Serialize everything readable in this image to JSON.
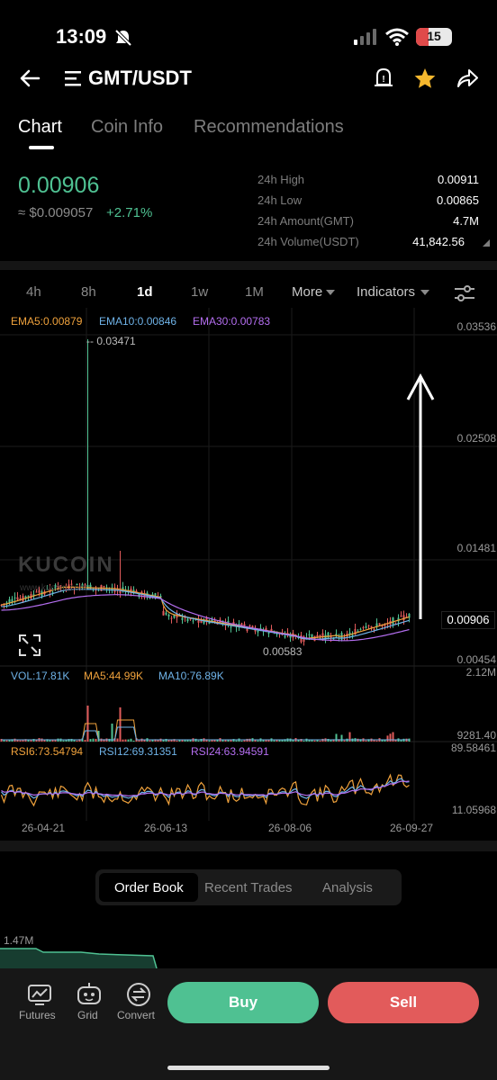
{
  "status": {
    "time": "13:09",
    "battery": "15"
  },
  "header": {
    "pair": "GMT/USDT"
  },
  "tabs": [
    "Chart",
    "Coin Info",
    "Recommendations"
  ],
  "ticker": {
    "price": "0.00906",
    "fiat": "≈ $0.009057",
    "change": "+2.71%",
    "stats": [
      {
        "label": "24h High",
        "value": "0.00911"
      },
      {
        "label": "24h Low",
        "value": "0.00865"
      },
      {
        "label": "24h Amount(GMT)",
        "value": "4.7M"
      },
      {
        "label": "24h Volume(USDT)",
        "value": "41,842.56"
      }
    ]
  },
  "timeframes": [
    "4h",
    "8h",
    "1d",
    "1w",
    "1M"
  ],
  "toolbar": {
    "more": "More",
    "indicators": "Indicators"
  },
  "ema": {
    "ema5": "EMA5:0.00879",
    "ema10": "EMA10:0.00846",
    "ema30": "EMA30:0.00783"
  },
  "price_axis": [
    "0.03536",
    "0.02508",
    "0.01481",
    "0.00454"
  ],
  "annotations": {
    "high": "-- 0.03471",
    "low": "0.00583",
    "current": "0.00906"
  },
  "watermark": "KUCOIN",
  "watermark_url": "www.kucoin.com",
  "volume": {
    "vol": "VOL:17.81K",
    "ma5": "MA5:44.99K",
    "ma10": "MA10:76.89K",
    "axis_top": "2.12M",
    "axis_bottom": "9281.40"
  },
  "rsi": {
    "rsi6": "RSI6:73.54794",
    "rsi12": "RSI12:69.31351",
    "rsi24": "RSI24:63.94591",
    "axis_top": "89.58461",
    "axis_bottom": "11.05968"
  },
  "dates": [
    "26-04-21",
    "26-06-13",
    "26-08-06",
    "26-09-27"
  ],
  "orderbook": {
    "tabs": [
      "Order Book",
      "Recent Trades",
      "Analysis"
    ],
    "depth_label": "1.47M"
  },
  "bottom_nav": [
    "Futures",
    "Grid",
    "Convert"
  ],
  "actions": {
    "buy": "Buy",
    "sell": "Sell"
  },
  "colors": {
    "up": "#4fc192",
    "down": "#e25b5b",
    "ema5": "#f0a23c",
    "ema10": "#6fb3e8",
    "ema30": "#b46ef0"
  }
}
